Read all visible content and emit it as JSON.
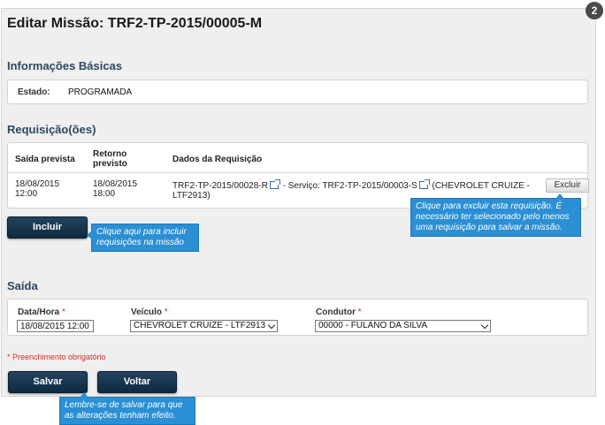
{
  "step_badge": "2",
  "page_title": "Editar Missão: TRF2-TP-2015/00005-M",
  "info": {
    "section_title": "Informações Básicas",
    "estado_label": "Estado:",
    "estado_value": "PROGRAMADA"
  },
  "requisicoes": {
    "section_title": "Requisição(ões)",
    "headers": {
      "saida": "Saída prevista",
      "retorno": "Retorno previsto",
      "dados": "Dados da Requisição"
    },
    "rows": [
      {
        "saida": "18/08/2015 12:00",
        "retorno": "18/08/2015 18:00",
        "req_code": "TRF2-TP-2015/00028-R",
        "servico_prefix": " - Serviço: ",
        "servico_code": "TRF2-TP-2015/00003-S",
        "veiculo": " (CHEVROLET CRUIZE - LTF2913)",
        "excluir_label": "Excluir"
      }
    ],
    "incluir_label": "Incluir"
  },
  "tooltips": {
    "incluir": "Clique aqui para incluir requisições na missão",
    "excluir": "Clique para excluir esta requisição. É necessário ter selecionado pelo menos uma requisição para salvar a missão.",
    "salvar": "Lembre-se de salvar para que as alterações tenham efeito."
  },
  "saida": {
    "section_title": "Saída",
    "datahora_label": "Data/Hora",
    "datahora_value": "18/08/2015 12:00",
    "veiculo_label": "Veículo",
    "veiculo_value": "CHEVROLET CRUIZE - LTF2913",
    "condutor_label": "Condutor",
    "condutor_value": "00000 - FULANO DA SILVA",
    "required_mark": "*"
  },
  "required_note": "* Preenchimento obrigatório",
  "actions": {
    "salvar_label": "Salvar",
    "voltar_label": "Voltar"
  },
  "colors": {
    "accent": "#2b8fd4",
    "button_dark": "#1a3850",
    "required": "#d03020"
  }
}
